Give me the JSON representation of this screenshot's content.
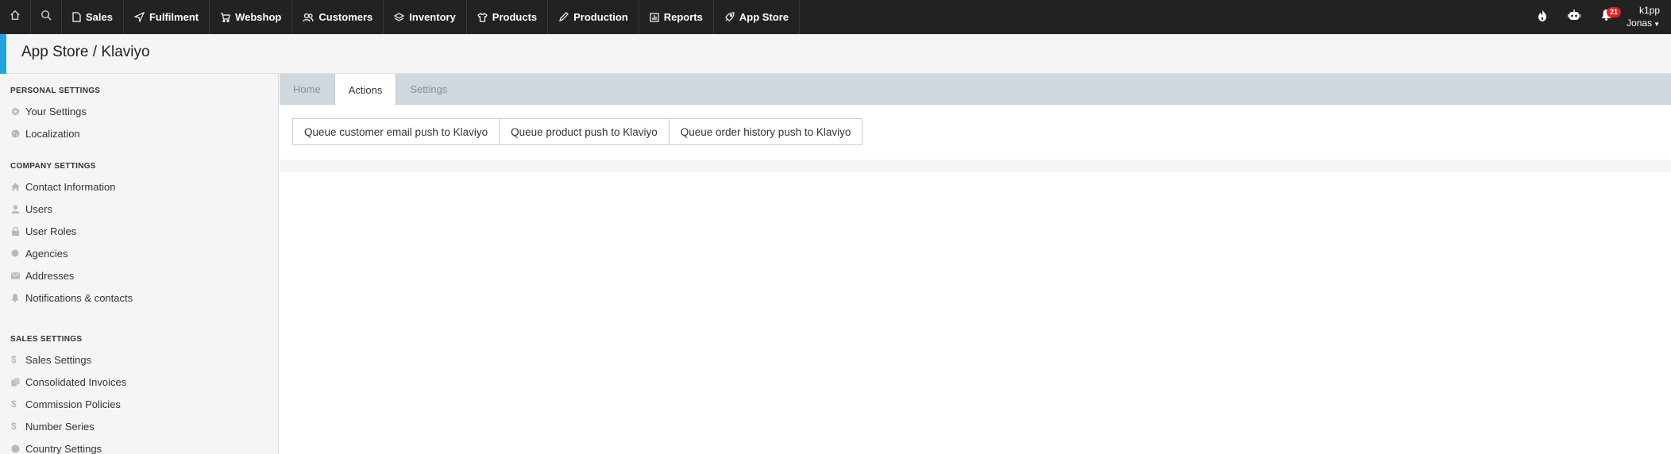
{
  "nav": {
    "items": [
      {
        "label": "Sales",
        "icon": "document-icon"
      },
      {
        "label": "Fulfilment",
        "icon": "paper-plane-icon"
      },
      {
        "label": "Webshop",
        "icon": "cart-icon"
      },
      {
        "label": "Customers",
        "icon": "users-icon"
      },
      {
        "label": "Inventory",
        "icon": "layers-icon"
      },
      {
        "label": "Products",
        "icon": "shirt-icon"
      },
      {
        "label": "Production",
        "icon": "pencil-icon"
      },
      {
        "label": "Reports",
        "icon": "bar-chart-icon"
      },
      {
        "label": "App Store",
        "icon": "rocket-icon"
      }
    ],
    "notifications_count": "21",
    "user": {
      "line1": "k1pp",
      "line2": "Jonas"
    }
  },
  "header": {
    "title": "App Store / Klaviyo",
    "accent_color": "#1fa6df"
  },
  "sidebar": {
    "sections": [
      {
        "title": "PERSONAL SETTINGS",
        "items": [
          {
            "label": "Your Settings",
            "icon": "gear-icon"
          },
          {
            "label": "Localization",
            "icon": "globe-icon"
          }
        ]
      },
      {
        "title": "COMPANY SETTINGS",
        "items": [
          {
            "label": "Contact Information",
            "icon": "home-icon"
          },
          {
            "label": "Users",
            "icon": "user-icon"
          },
          {
            "label": "User Roles",
            "icon": "lock-icon"
          },
          {
            "label": "Agencies",
            "icon": "circle-icon"
          },
          {
            "label": "Addresses",
            "icon": "envelope-icon"
          },
          {
            "label": "Notifications & contacts",
            "icon": "bell-icon"
          }
        ]
      },
      {
        "title": "SALES SETTINGS",
        "items": [
          {
            "label": "Sales Settings",
            "icon": "dollar-icon"
          },
          {
            "label": "Consolidated Invoices",
            "icon": "documents-icon"
          },
          {
            "label": "Commission Policies",
            "icon": "dollar-icon"
          },
          {
            "label": "Number Series",
            "icon": "dollar-icon"
          },
          {
            "label": "Country Settings",
            "icon": "globe-icon"
          }
        ]
      }
    ]
  },
  "tabs": [
    {
      "label": "Home"
    },
    {
      "label": "Actions"
    },
    {
      "label": "Settings"
    }
  ],
  "active_tab": "Actions",
  "actions": [
    {
      "label": "Queue customer email push to Klaviyo"
    },
    {
      "label": "Queue product push to Klaviyo"
    },
    {
      "label": "Queue order history push to Klaviyo"
    }
  ]
}
